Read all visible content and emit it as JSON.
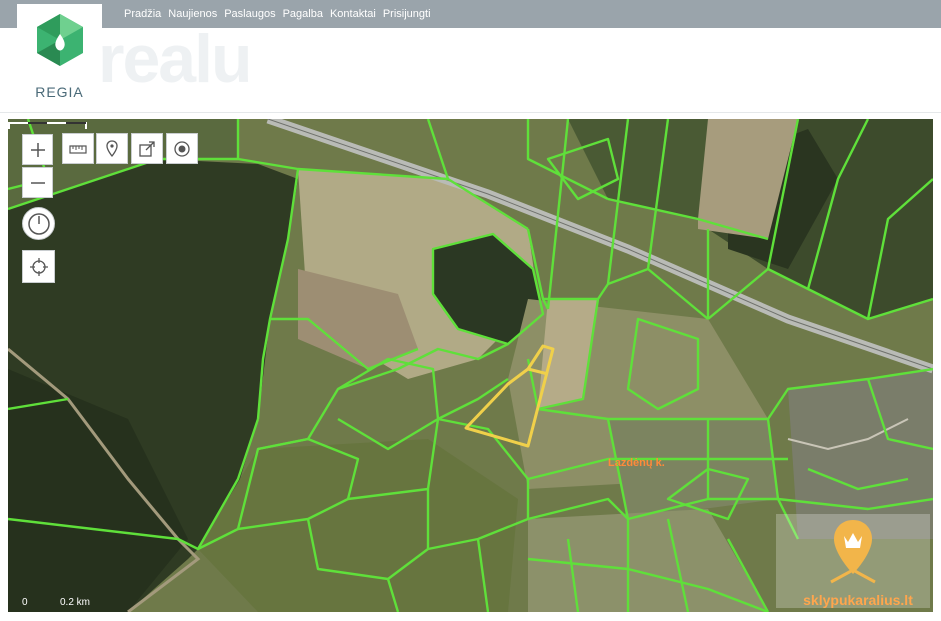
{
  "nav": {
    "items": [
      "Pradžia",
      "Naujienos",
      "Paslaugos",
      "Pagalba",
      "Kontaktai",
      "Prisijungti"
    ]
  },
  "logo": {
    "text": "REGIA"
  },
  "watermark": {
    "text": "realu"
  },
  "map": {
    "place_label": "Lazdėnų k.",
    "scale": {
      "zero": "0",
      "distance": "0.2 km"
    },
    "controls": {
      "zoom_in": "plus-icon",
      "zoom_out": "minus-icon",
      "measure": "ruler-icon",
      "marker": "map-pin-icon",
      "share": "share-icon",
      "locate": "target-icon",
      "history": "clock-icon",
      "crosshair": "crosshair-icon"
    },
    "brand": "sklypukaralius.lt",
    "colors": {
      "parcel": "#5fe03a",
      "selected": "#f0d04a",
      "road": "#b9bbb6"
    }
  }
}
